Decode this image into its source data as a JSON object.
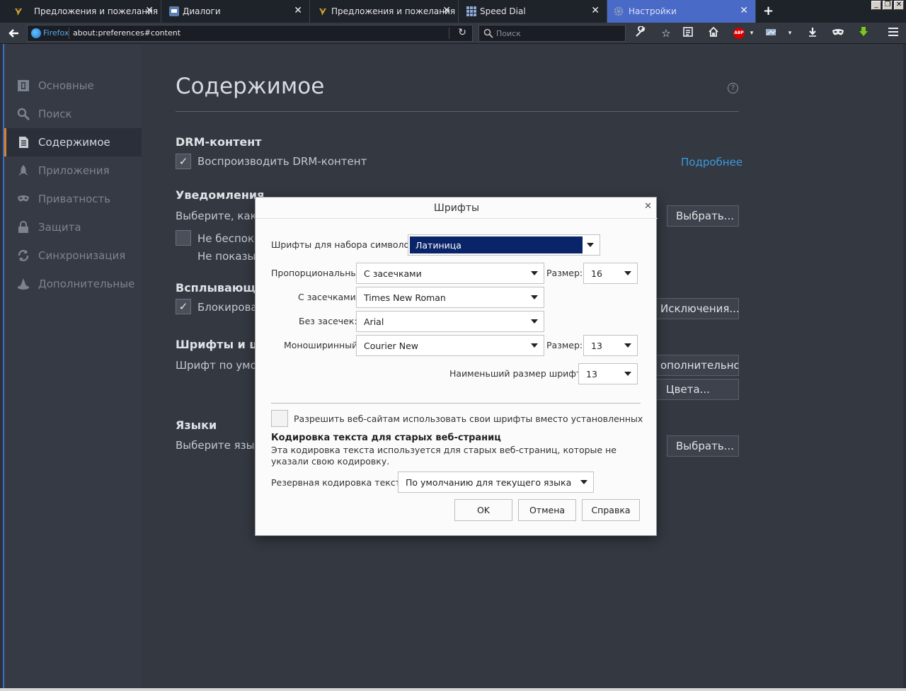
{
  "tabs": [
    {
      "label": "Предложения и пожелания",
      "icon": "forum-icon"
    },
    {
      "label": "Диалоги",
      "icon": "dialogs-icon"
    },
    {
      "label": "Предложения и пожелания",
      "icon": "forum-icon"
    },
    {
      "label": "Speed Dial",
      "icon": "grid-icon"
    },
    {
      "label": "Настройки",
      "icon": "gear-icon",
      "active": true
    }
  ],
  "navbar": {
    "browser_label": "Firefox",
    "url": "about:preferences#content",
    "search_placeholder": "Поиск"
  },
  "sidebar": {
    "items": [
      {
        "label": "Основные",
        "icon": "general-icon"
      },
      {
        "label": "Поиск",
        "icon": "search-icon"
      },
      {
        "label": "Содержимое",
        "icon": "document-icon",
        "active": true
      },
      {
        "label": "Приложения",
        "icon": "rocket-icon"
      },
      {
        "label": "Приватность",
        "icon": "mask-icon"
      },
      {
        "label": "Защита",
        "icon": "lock-icon"
      },
      {
        "label": "Синхронизация",
        "icon": "sync-icon"
      },
      {
        "label": "Дополнительные",
        "icon": "wizard-icon"
      }
    ]
  },
  "main": {
    "title": "Содержимое",
    "drm_heading": "DRM-контент",
    "drm_checkbox": "Воспроизводить DRM-контент",
    "drm_link": "Подробнее",
    "notif_heading": "Уведомления",
    "notif_text": "Выберите, каки",
    "notif_btn": "Выбрать...",
    "dnd_checkbox": "Не беспоко",
    "dnd_sub": "Не показы",
    "popup_heading": "Всплывающ",
    "popup_checkbox": "Блокироват",
    "popup_btn": "Исключения...",
    "fonts_heading": "Шрифты и ц",
    "fonts_text": "Шрифт по умол",
    "fonts_adv_btn": "ополнительно...",
    "colors_btn": "Цвета...",
    "lang_heading": "Языки",
    "lang_text": "Выберите язык",
    "lang_btn": "Выбрать..."
  },
  "dialog": {
    "title": "Шрифты",
    "charset_label": "Шрифты для набора символов:",
    "charset_value": "Латиница",
    "proportional_label": "Пропорциональный",
    "proportional_value": "С засечками",
    "size_label": "Размер:",
    "proportional_size": "16",
    "serif_label": "С засечками:",
    "serif_value": "Times New Roman",
    "sans_label": "Без засечек:",
    "sans_value": "Arial",
    "mono_label": "Моноширинный:",
    "mono_value": "Courier New",
    "mono_size_label": "Размер:",
    "mono_size": "13",
    "min_size_label": "Наименьший размер шрифта:",
    "min_size": "13",
    "allow_pages_label": "Разрешить веб-сайтам использовать свои шрифты вместо установленных",
    "allow_pages_checked": false,
    "encoding_heading": "Кодировка текста для старых веб-страниц",
    "encoding_desc": "Эта кодировка текста используется для старых веб-страниц, которые не указали свою кодировку.",
    "fallback_label": "Резервная кодировка текста:",
    "fallback_value": "По умолчанию для текущего языка",
    "ok": "OK",
    "cancel": "Отмена",
    "help": "Справка"
  },
  "colors": {
    "accent": "#3b9ae0",
    "active_tab": "#4a6ac8",
    "sidebar_active_marker": "#e07f2a",
    "selection": "#0a246a"
  }
}
